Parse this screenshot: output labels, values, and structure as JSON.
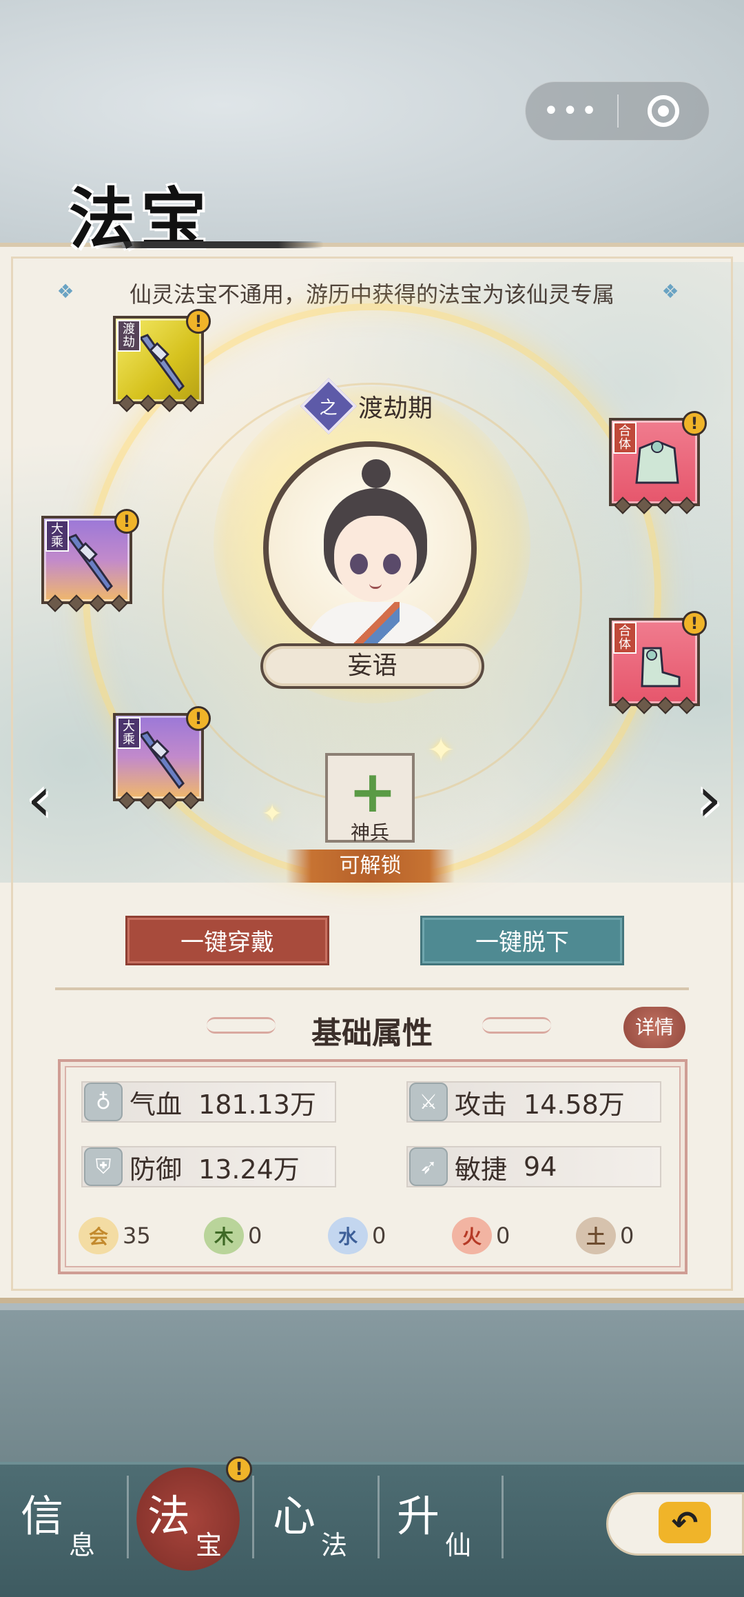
{
  "header": {
    "title": "法宝",
    "menu_label": "•••"
  },
  "panel": {
    "subtitle": "仙灵法宝不通用，游历中获得的法宝为该仙灵专属",
    "realm_icon": "之",
    "realm": "渡劫期",
    "character_name": "妄语"
  },
  "equipment": [
    {
      "id": "weapon-top-left",
      "tag": "渡劫",
      "alert": "!",
      "rarity": "yellow"
    },
    {
      "id": "weapon-mid-left",
      "tag": "大乘",
      "alert": "!",
      "rarity": "purple"
    },
    {
      "id": "weapon-bottom-left",
      "tag": "大乘",
      "alert": "!",
      "rarity": "purple"
    },
    {
      "id": "armor-right",
      "tag": "合体",
      "alert": "!",
      "rarity": "pink"
    },
    {
      "id": "boots-right",
      "tag": "合体",
      "alert": "!",
      "rarity": "pink"
    }
  ],
  "shenbing": {
    "label": "神兵",
    "unlock": "可解锁"
  },
  "actions": {
    "wear_all": "一键穿戴",
    "remove_all": "一键脱下"
  },
  "attributes": {
    "section_title": "基础属性",
    "detail": "详情",
    "hp_label": "气血",
    "hp_value": "181.13万",
    "atk_label": "攻击",
    "atk_value": "14.58万",
    "def_label": "防御",
    "def_value": "13.24万",
    "agi_label": "敏捷",
    "agi_value": "94"
  },
  "elements": [
    {
      "char": "会",
      "value": "35",
      "color": "#e7b969"
    },
    {
      "char": "木",
      "value": "0",
      "color": "#7fae5b"
    },
    {
      "char": "水",
      "value": "0",
      "color": "#7fa3d0"
    },
    {
      "char": "火",
      "value": "0",
      "color": "#e07a5e"
    },
    {
      "char": "土",
      "value": "0",
      "color": "#a8876a"
    }
  ],
  "tabs": [
    {
      "big": "信",
      "small": "息"
    },
    {
      "big": "法",
      "small": "宝"
    },
    {
      "big": "心",
      "small": "法"
    },
    {
      "big": "升",
      "small": "仙"
    }
  ],
  "tab_alert": "!",
  "nav": {
    "prev": "‹",
    "next": "›",
    "back": "↶"
  }
}
